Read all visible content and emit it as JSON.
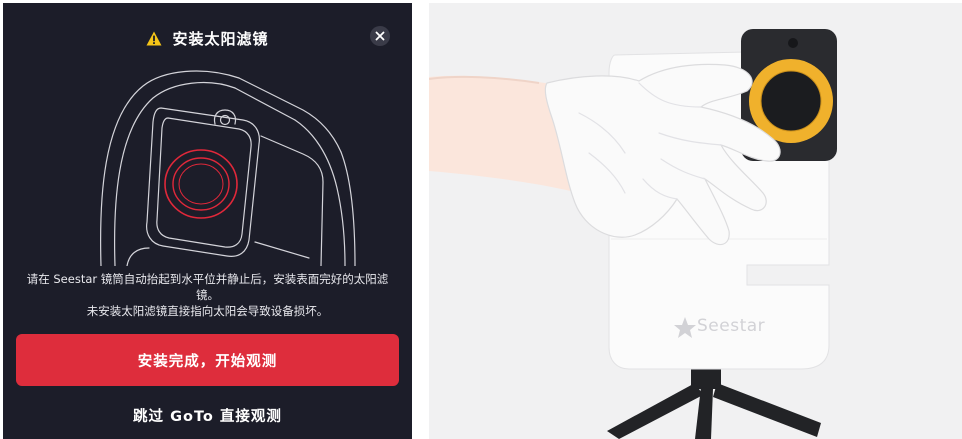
{
  "dialog": {
    "title": "安装太阳滤镜",
    "instruction_line1": "请在 Seestar 镜筒自动抬起到水平位并静止后，安装表面完好的太阳滤镜。",
    "instruction_line2": "未安装太阳滤镜直接指向太阳会导致设备损坏。",
    "primary_button": "安装完成，开始观测",
    "secondary_button": "跳过 GoTo 直接观测",
    "colors": {
      "background": "#1c1d29",
      "primary": "#de2d3c",
      "warning": "#f5c518"
    }
  },
  "photo": {
    "brand_label": "Seestar"
  }
}
